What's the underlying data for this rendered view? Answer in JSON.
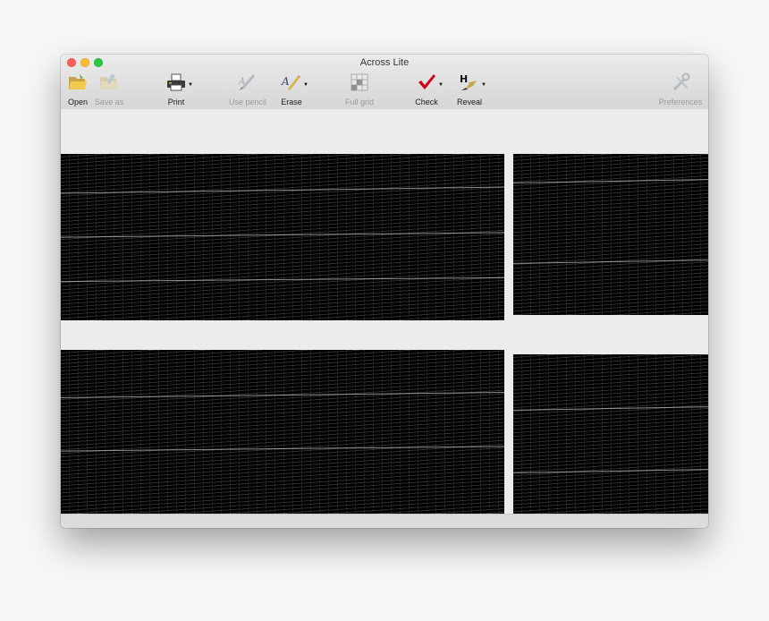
{
  "window": {
    "title": "Across Lite"
  },
  "colors": {
    "close": "#fe5f57",
    "minimize": "#febc2e",
    "maximize": "#28c840",
    "check_mark": "#d0021b"
  },
  "toolbar": {
    "open_label": "Open",
    "save_as_label": "Save as",
    "print_label": "Print",
    "use_pencil_label": "Use pencil",
    "erase_label": "Erase",
    "full_grid_label": "Full grid",
    "check_label": "Check",
    "reveal_label": "Reveal",
    "preferences_label": "Preferences"
  },
  "icons": {
    "open": "folder-open-icon",
    "save_as": "save-as-icon",
    "print": "printer-icon",
    "use_pencil": "pencil-icon",
    "erase": "eraser-icon",
    "full_grid": "grid-icon",
    "check": "checkmark-icon",
    "reveal": "reveal-icon",
    "preferences": "wrench-screwdriver-icon"
  }
}
